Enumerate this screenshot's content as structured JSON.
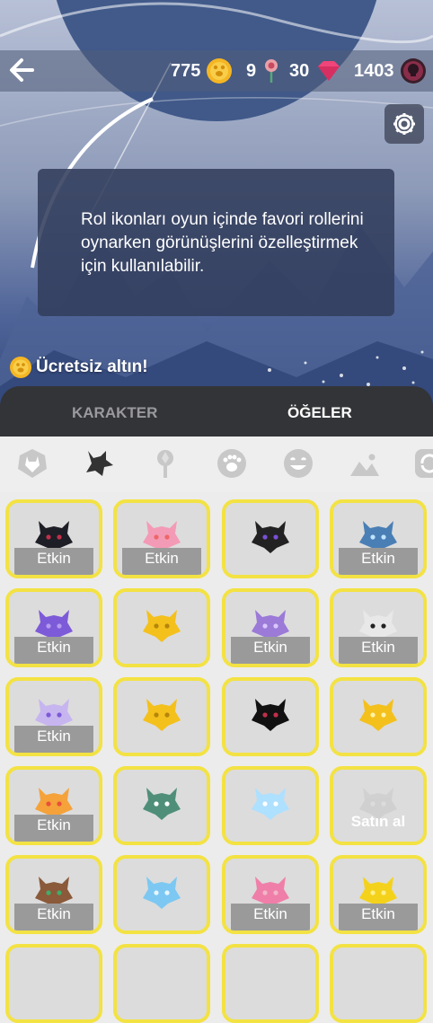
{
  "header": {
    "currencies": {
      "gold": "775",
      "roses": "9",
      "gems": "30",
      "points": "1403"
    }
  },
  "info_text": "Rol ikonları oyun içinde favori rollerini oynarken görünüşlerini özelleştirmek için kullanılabilir.",
  "free_gold": "Ücretsiz altın!",
  "tabs": [
    {
      "label": "KARAKTER",
      "active": false
    },
    {
      "label": "ÖĞELER",
      "active": true
    }
  ],
  "categories": [
    "wolf-head-icon",
    "wolf-icon",
    "rose-icon",
    "paw-icon",
    "emoji-icon",
    "landscape-icon",
    "refresh-icon"
  ],
  "colors": {
    "accent": "#f3e243",
    "tab_bg": "#333437",
    "overlay": "#9a9a9a"
  },
  "items": [
    {
      "name": "item-wolf-red-eyes",
      "label": "Etkin",
      "color": "#1e1e26",
      "accent": "#c0304a"
    },
    {
      "name": "item-wolf-pink-bandage",
      "label": "Etkin",
      "color": "#f39bb6",
      "accent": "#e66"
    },
    {
      "name": "item-wolf-rainbow",
      "label": "",
      "color": "#222",
      "accent": "#7b4fd6"
    },
    {
      "name": "item-wolf-blue-ice",
      "label": "Etkin",
      "color": "#4a7fb5",
      "accent": "#bfe3ff"
    },
    {
      "name": "item-purple-hood",
      "label": "Etkin",
      "color": "#7d5ad8",
      "accent": "#b59cf0"
    },
    {
      "name": "item-yellow-hood",
      "label": "",
      "color": "#f4c01c",
      "accent": "#b5860a"
    },
    {
      "name": "item-wolf-purple",
      "label": "Etkin",
      "color": "#9b7ad8",
      "accent": "#d9c6ff"
    },
    {
      "name": "item-white-spirit",
      "label": "Etkin",
      "color": "#e8e8e8",
      "accent": "#222"
    },
    {
      "name": "item-purple-eye",
      "label": "Etkin",
      "color": "#c7b5f0",
      "accent": "#7d5ad8"
    },
    {
      "name": "item-yellow-eye",
      "label": "",
      "color": "#f4c01c",
      "accent": "#b5860a"
    },
    {
      "name": "item-dark-eye",
      "label": "",
      "color": "#111",
      "accent": "#c0304a"
    },
    {
      "name": "item-gold-bones",
      "label": "",
      "color": "#f4c01c",
      "accent": "#fff3a8"
    },
    {
      "name": "item-orange-wolf-bones",
      "label": "Etkin",
      "color": "#f5a23b",
      "accent": "#e8503a"
    },
    {
      "name": "item-green-wolf-bones",
      "label": "",
      "color": "#4f8f7a",
      "accent": "#fff"
    },
    {
      "name": "item-ice-bones",
      "label": "",
      "color": "#aee0ff",
      "accent": "#fff"
    },
    {
      "name": "item-faded-wolf",
      "label": "Satın al",
      "color": "#bcbcbc",
      "accent": "#ddd",
      "faded": true
    },
    {
      "name": "item-brown-wolf",
      "label": "Etkin",
      "color": "#8a5a3a",
      "accent": "#3fae6a"
    },
    {
      "name": "item-ice-drop",
      "label": "",
      "color": "#7cc8f2",
      "accent": "#e6f6ff"
    },
    {
      "name": "item-pink-unicorn",
      "label": "Etkin",
      "color": "#ef7fa8",
      "accent": "#f3b5c9"
    },
    {
      "name": "item-jester-hat",
      "label": "Etkin",
      "color": "#f4d21c",
      "accent": "#ffef8a"
    }
  ]
}
